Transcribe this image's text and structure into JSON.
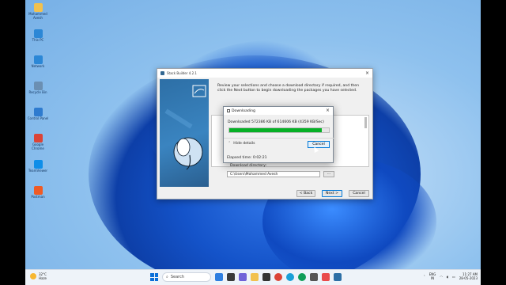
{
  "desktop_icons": [
    {
      "label": "Mohammed Avesh",
      "icon": "folder-icon",
      "color": "#f2c14e"
    },
    {
      "label": "This PC",
      "icon": "monitor-icon",
      "color": "#2b87d6"
    },
    {
      "label": "Network",
      "icon": "network-icon",
      "color": "#2b87d6"
    },
    {
      "label": "Recycle Bin",
      "icon": "recycle-bin-icon",
      "color": "#6b8fb2"
    },
    {
      "label": "Control Panel",
      "icon": "control-panel-icon",
      "color": "#2e7bcf"
    },
    {
      "label": "Google Chrome",
      "icon": "chrome-icon",
      "color": "#db4437"
    },
    {
      "label": "TeamViewer",
      "icon": "teamviewer-icon",
      "color": "#0e8ee9"
    },
    {
      "label": "Postman",
      "icon": "postman-icon",
      "color": "#ef5b25"
    }
  ],
  "stack_builder": {
    "title": "Stack Builder 4.2.1",
    "description": "Review your selections and choose a download directory if required, and then click the Next button to begin downloading the packages you have selected.",
    "directory_label": "Download directory:",
    "directory_value": "C:\\Users\\Mohammed Avesh",
    "browse_label": "...",
    "back_label": "< Back",
    "next_label": "Next >",
    "cancel_label": "Cancel"
  },
  "download_dialog": {
    "title": "Downloading",
    "status": "Downloaded 572386 KB of  614606 KB (4359 KB/Sec)",
    "progress": 0.93,
    "hide_details_label": "Hide details",
    "cancel_label": "Cancel",
    "elapsed": "Elapsed time: 0:02:21"
  },
  "taskbar": {
    "weather_temp": "32°C",
    "weather_desc": "Haze",
    "search_placeholder": "Search",
    "language": "ENG",
    "region": "IN",
    "time": "11:27 AM",
    "date": "28-05-2023"
  },
  "colors": {
    "progress_fill": "#06b025",
    "accent": "#0078d7"
  }
}
